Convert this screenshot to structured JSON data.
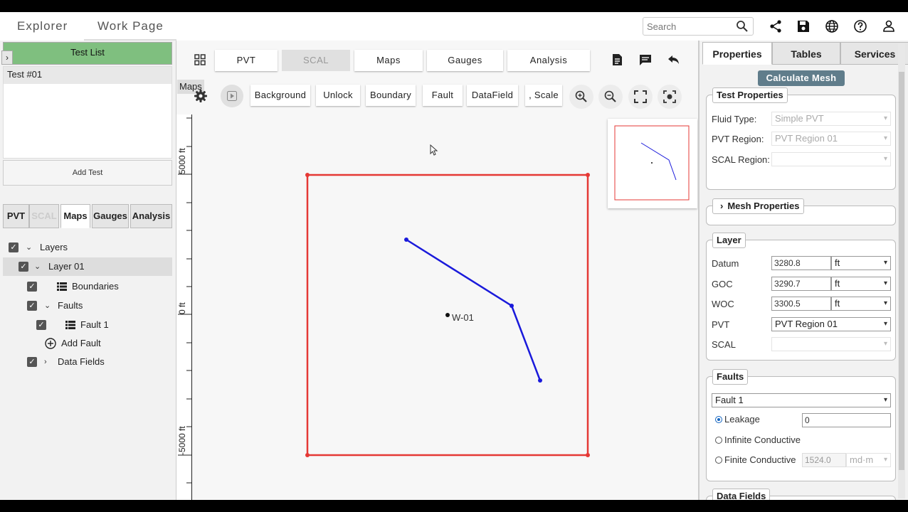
{
  "header": {
    "tabs": [
      "Explorer",
      "Work Page"
    ],
    "active_tab": "Work Page",
    "search_placeholder": "Search",
    "icons": [
      "search-icon",
      "share-icon",
      "save-icon",
      "globe-icon",
      "help-icon",
      "user-icon"
    ]
  },
  "left_panel": {
    "test_list_title": "Test List",
    "tests": [
      "Test #01"
    ],
    "add_test_label": "Add Test",
    "tabs": [
      {
        "label": "PVT",
        "state": "normal"
      },
      {
        "label": "SCAL",
        "state": "disabled"
      },
      {
        "label": "Maps",
        "state": "active"
      },
      {
        "label": "Gauges",
        "state": "normal"
      },
      {
        "label": "Analysis",
        "state": "normal"
      }
    ],
    "tree": {
      "layers": "Layers",
      "layer_01": "Layer 01",
      "boundaries": "Boundaries",
      "faults": "Faults",
      "fault_1": "Fault 1",
      "add_fault": "Add Fault",
      "data_fields": "Data Fields"
    }
  },
  "toolbar": {
    "tabs": [
      {
        "label": "PVT",
        "state": "normal"
      },
      {
        "label": "SCAL",
        "state": "disabled"
      },
      {
        "label": "Maps",
        "state": "normal"
      },
      {
        "label": "Gauges",
        "state": "normal"
      },
      {
        "label": "Analysis",
        "state": "normal"
      }
    ],
    "tooltip": "Maps",
    "buttons": {
      "background": "Background",
      "unlock": "Unlock",
      "boundary": "Boundary",
      "fault": "Fault",
      "datafield": "DataField",
      "scale": ", Scale"
    }
  },
  "map": {
    "ruler_labels": [
      "5000 ft",
      "0 ft",
      "-5000 ft"
    ],
    "well_name": "W-01",
    "boundary_color": "#e53935",
    "fault_color": "#1a1adb"
  },
  "right_panel": {
    "tabs": [
      {
        "label": "Properties",
        "state": "active"
      },
      {
        "label": "Tables",
        "state": "normal"
      },
      {
        "label": "Services",
        "state": "normal"
      }
    ],
    "calculate_mesh_label": "Calculate Mesh",
    "test_properties": {
      "title": "Test Properties",
      "fluid_type_label": "Fluid Type:",
      "fluid_type_value": "Simple PVT",
      "pvt_region_label": "PVT Region:",
      "pvt_region_value": "PVT Region 01",
      "scal_region_label": "SCAL Region:",
      "scal_region_value": ""
    },
    "mesh_properties_title": "Mesh Properties",
    "layer": {
      "title": "Layer",
      "datum_label": "Datum",
      "datum_value": "3280.8",
      "datum_unit": "ft",
      "goc_label": "GOC",
      "goc_value": "3290.7",
      "goc_unit": "ft",
      "woc_label": "WOC",
      "woc_value": "3300.5",
      "woc_unit": "ft",
      "pvt_label": "PVT",
      "pvt_value": "PVT Region 01",
      "scal_label": "SCAL",
      "scal_value": ""
    },
    "faults": {
      "title": "Faults",
      "selected_fault": "Fault 1",
      "leakage_label": "Leakage",
      "leakage_value": "0",
      "infinite_label": "Infinite Conductive",
      "finite_label": "Finite Conductive",
      "finite_value": "1524.0",
      "finite_unit": "md·m",
      "selected_option": "Leakage"
    },
    "data_fields_title": "Data Fields"
  }
}
